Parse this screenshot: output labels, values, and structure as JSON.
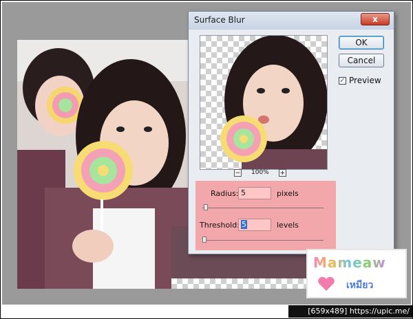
{
  "dialog": {
    "title": "Surface Blur",
    "close_label": "x",
    "ok_label": "OK",
    "cancel_label": "Cancel",
    "preview_label": "Preview",
    "preview_checked": true,
    "zoom_minus": "−",
    "zoom_plus": "+",
    "zoom_value": "100%",
    "radius_label": "Radius:",
    "radius_value": "5",
    "radius_unit": "pixels",
    "threshold_label": "Threshold:",
    "threshold_value": "5",
    "threshold_unit": "levels"
  },
  "watermark": {
    "title": "Mameaw",
    "subtitle": "เหมียว"
  },
  "footer": {
    "text": "[659x489] https://upic.me/"
  },
  "colors": {
    "param_panel": "#f2a7aa",
    "close": "#c63b25",
    "canvas_bg": "#9a9a9a"
  }
}
